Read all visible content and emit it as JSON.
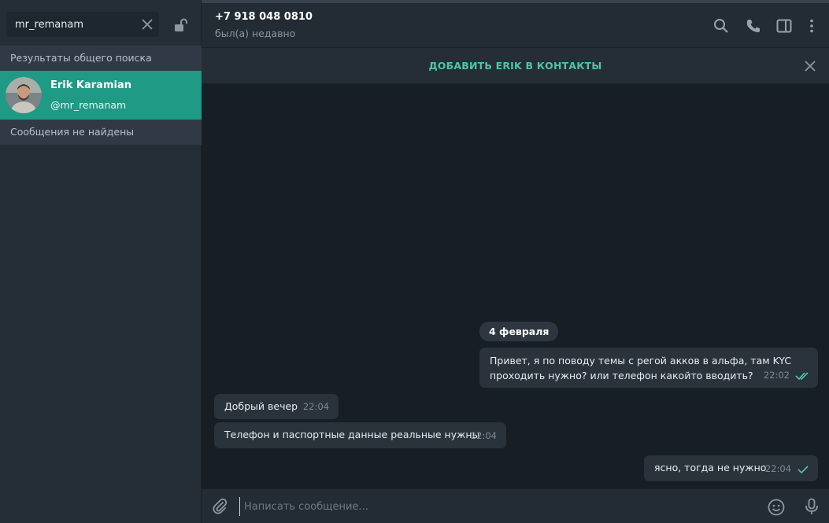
{
  "search": {
    "value": "mr_remanam"
  },
  "sidebar": {
    "global_results_header": "Результаты общего поиска",
    "result": {
      "name": "Erik Karamian",
      "username": "@mr_remanam"
    },
    "no_messages": "Сообщения не найдены"
  },
  "header": {
    "phone": "+7 918 048 0810",
    "status": "был(а) недавно"
  },
  "banner": {
    "add_contact_label": "ДОБАВИТЬ ERIK В КОНТАКТЫ"
  },
  "chat": {
    "date_chip": "4 февраля",
    "messages": [
      {
        "text_line1": "Привет, я по поводу темы с регой акков в альфа, там KYC",
        "text_line2": "проходить нужно? или телефон какойто вводить?",
        "time": "22:02",
        "outgoing": true
      },
      {
        "text": "Добрый вечер",
        "time": "22:04",
        "outgoing": false
      },
      {
        "text": "Телефон и паспортные данные реальные нужны",
        "time": "22:04",
        "outgoing": false
      },
      {
        "text": "ясно, тогда не нужно",
        "time": "22:04",
        "outgoing": true
      }
    ]
  },
  "composer": {
    "placeholder": "Написать сообщение..."
  },
  "colors": {
    "accent": "#1f9a85",
    "link": "#4fc6a6",
    "check": "#4fc6a6"
  },
  "icons": [
    "close-icon",
    "lock-icon",
    "search-icon",
    "phone-icon",
    "sidebar-panel-icon",
    "more-vert-icon",
    "attach-icon",
    "emoji-icon",
    "mic-icon",
    "double-check-icon",
    "check-icon"
  ]
}
